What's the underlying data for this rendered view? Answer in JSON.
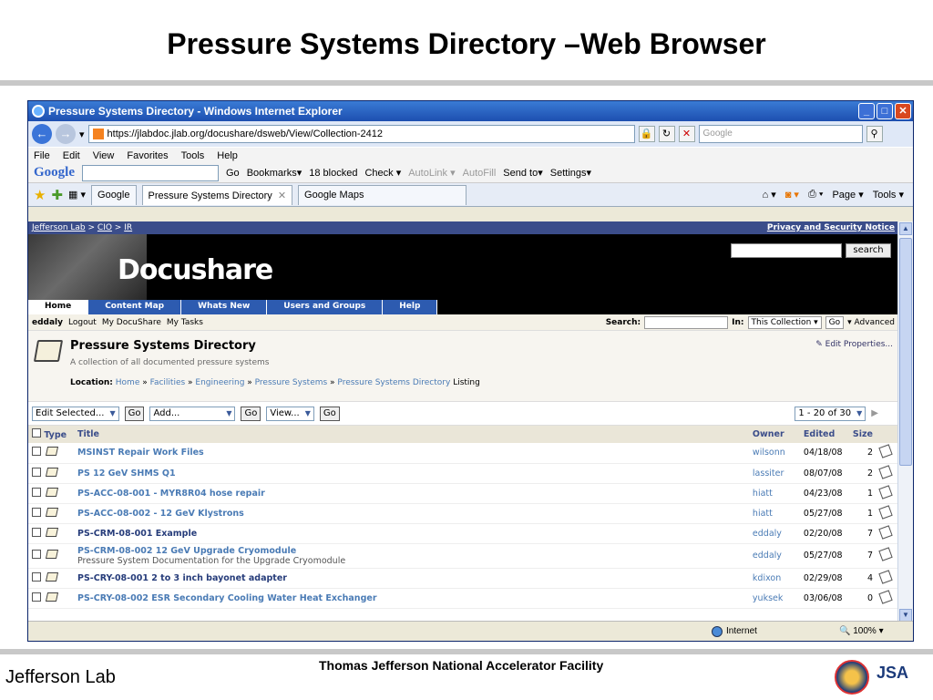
{
  "slide": {
    "title": "Pressure Systems Directory –Web Browser",
    "footer_org": "Thomas Jefferson National Accelerator Facility",
    "logo_text": "Jefferson Lab",
    "jsa_text": "JSA"
  },
  "browser": {
    "window_title": "Pressure Systems Directory - Windows Internet Explorer",
    "url": "https://jlabdoc.jlab.org/docushare/dsweb/View/Collection-2412",
    "search_placeholder": "Google",
    "menu": [
      "File",
      "Edit",
      "View",
      "Favorites",
      "Tools",
      "Help"
    ],
    "google_toolbar": {
      "go": "Go",
      "bookmarks": "Bookmarks▾",
      "blocked": "18 blocked",
      "check": "Check ▾",
      "autolink": "AutoLink ▾",
      "autofill": "AutoFill",
      "sendto": "Send to▾",
      "settings": "Settings▾"
    },
    "tabs": [
      {
        "label": "Google"
      },
      {
        "label": "Pressure Systems Directory"
      },
      {
        "label": "Google Maps"
      }
    ],
    "command_bar": {
      "page": "Page ▾",
      "tools": "Tools ▾"
    },
    "status": {
      "zone": "Internet",
      "zoom": "100%"
    }
  },
  "site": {
    "breadcrumb": [
      "Jefferson Lab",
      "CIO",
      "IR"
    ],
    "privacy": "Privacy and Security Notice",
    "logo": "Docushare",
    "search_button": "search",
    "nav_tabs": [
      "Home",
      "Content Map",
      "Whats New",
      "Users and Groups",
      "Help"
    ],
    "user": {
      "name": "eddaly",
      "logout": "Logout",
      "my_docushare": "My DocuShare",
      "my_tasks": "My Tasks",
      "search_label": "Search:",
      "in_label": "In:",
      "scope": "This Collection",
      "go": "Go",
      "advanced": "▾ Advanced"
    },
    "collection": {
      "title": "Pressure Systems Directory",
      "description": "A collection of all documented pressure systems",
      "edit_properties": "Edit Properties...",
      "location_label": "Location:",
      "location": [
        "Home",
        "Facilities",
        "Engineering",
        "Pressure Systems",
        "Pressure Systems Directory"
      ],
      "location_suffix": "Listing"
    },
    "actions": {
      "edit_selected": "Edit Selected...",
      "add": "Add...",
      "view": "View...",
      "go": "Go",
      "pager": "1 - 20 of 30"
    },
    "table": {
      "headers": {
        "type": "Type",
        "title": "Title",
        "owner": "Owner",
        "edited": "Edited",
        "size": "Size"
      },
      "rows": [
        {
          "title": "MSINST Repair Work Files",
          "subtitle": "",
          "owner": "wilsonn",
          "edited": "04/18/08",
          "size": "2"
        },
        {
          "title": "PS 12 GeV SHMS Q1",
          "subtitle": "",
          "owner": "lassiter",
          "edited": "08/07/08",
          "size": "2"
        },
        {
          "title": "PS-ACC-08-001 - MYR8R04 hose repair",
          "subtitle": "",
          "owner": "hiatt",
          "edited": "04/23/08",
          "size": "1"
        },
        {
          "title": "PS-ACC-08-002 - 12 GeV Klystrons",
          "subtitle": "",
          "owner": "hiatt",
          "edited": "05/27/08",
          "size": "1"
        },
        {
          "title": "PS-CRM-08-001 Example",
          "subtitle": "",
          "owner": "eddaly",
          "edited": "02/20/08",
          "size": "7"
        },
        {
          "title": "PS-CRM-08-002 12 GeV Upgrade Cryomodule",
          "subtitle": "Pressure System Documentation for the Upgrade Cryomodule",
          "owner": "eddaly",
          "edited": "05/27/08",
          "size": "7"
        },
        {
          "title": "PS-CRY-08-001 2 to 3 inch bayonet adapter",
          "subtitle": "",
          "owner": "kdixon",
          "edited": "02/29/08",
          "size": "4"
        },
        {
          "title": "PS-CRY-08-002 ESR Secondary Cooling Water Heat Exchanger",
          "subtitle": "",
          "owner": "yuksek",
          "edited": "03/06/08",
          "size": "0"
        }
      ]
    }
  }
}
